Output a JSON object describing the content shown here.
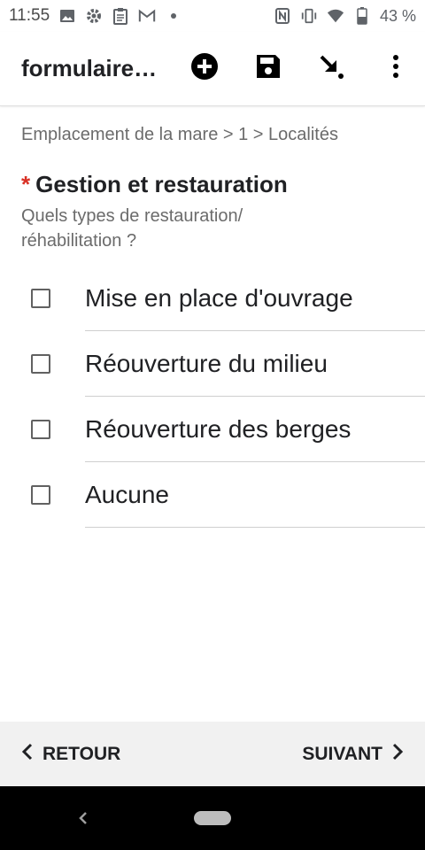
{
  "status_bar": {
    "time": "11:55",
    "battery_text": "43 %",
    "icons_left": [
      "image-icon",
      "gear-icon",
      "clipboard-icon",
      "gmail-icon",
      "dot-icon"
    ],
    "icons_right": [
      "nfc-icon",
      "vibrate-icon",
      "wifi-icon",
      "battery-icon"
    ]
  },
  "appbar": {
    "title": "formulaire…",
    "actions": [
      "add-circle-icon",
      "save-icon",
      "go-to-icon",
      "more-vert-icon"
    ]
  },
  "breadcrumb": "Emplacement de la mare > 1 > Localités",
  "question": {
    "required_mark": "*",
    "title": "Gestion et restauration",
    "hint": "Quels types de restauration/ réhabilitation ?"
  },
  "options": [
    {
      "label": "Mise en place d'ouvrage",
      "checked": false
    },
    {
      "label": "Réouverture du milieu",
      "checked": false
    },
    {
      "label": "Réouverture des berges",
      "checked": false
    },
    {
      "label": "Aucune",
      "checked": false
    }
  ],
  "nav": {
    "back_label": "RETOUR",
    "next_label": "SUIVANT"
  },
  "colors": {
    "required": "#d93025",
    "bottom_bar": "#f1f1f1",
    "system_nav": "#000000"
  }
}
